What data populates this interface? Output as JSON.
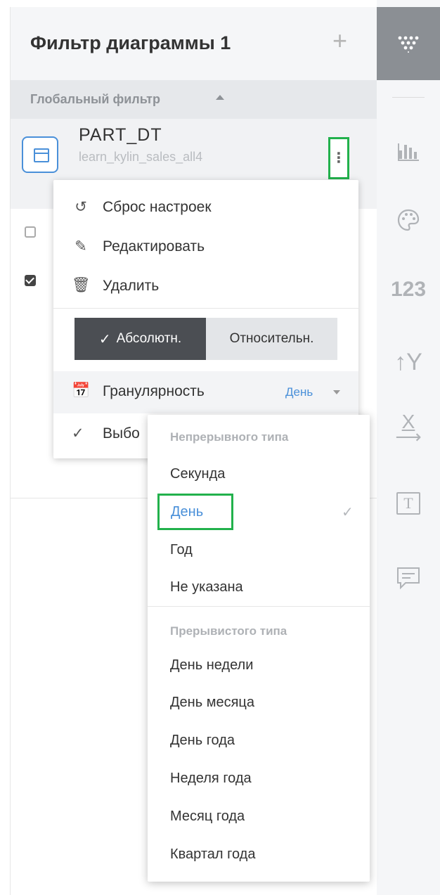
{
  "panel": {
    "title": "Фильтр диаграммы  1",
    "add_label": "+",
    "global_filter_label": "Глобальный фильтр"
  },
  "field": {
    "name": "PART_DT",
    "table": "learn_kylin_sales_all4",
    "more_label": "⋮"
  },
  "context_menu": {
    "items": [
      {
        "icon": "reset-icon",
        "label": "Сброс настроек"
      },
      {
        "icon": "edit-icon",
        "label": "Редактировать"
      },
      {
        "icon": "trash-icon",
        "label": "Удалить"
      }
    ],
    "segment": {
      "absolute_label": "Абсолютн.",
      "relative_label": "Относительн.",
      "selected": "absolute"
    },
    "granularity": {
      "label": "Гранулярность",
      "value": "День"
    },
    "select_label": "Выбо"
  },
  "dropdown": {
    "group_continuous": "Непрерывного типа",
    "continuous_options": [
      "Секунда",
      "День",
      "Год",
      "Не указана"
    ],
    "group_discrete": "Прерывистого типа",
    "discrete_options": [
      "День недели",
      "День месяца",
      "День года",
      "Неделя года",
      "Месяц года",
      "Квартал года"
    ],
    "selected": "День"
  },
  "sidebar": {
    "number_label": "123",
    "y_label": "↑Y",
    "x_label": "X",
    "text_label": "T"
  },
  "colors": {
    "accent": "#4a90d9",
    "highlight": "#22b14c",
    "active_segment": "#4b4e53"
  }
}
